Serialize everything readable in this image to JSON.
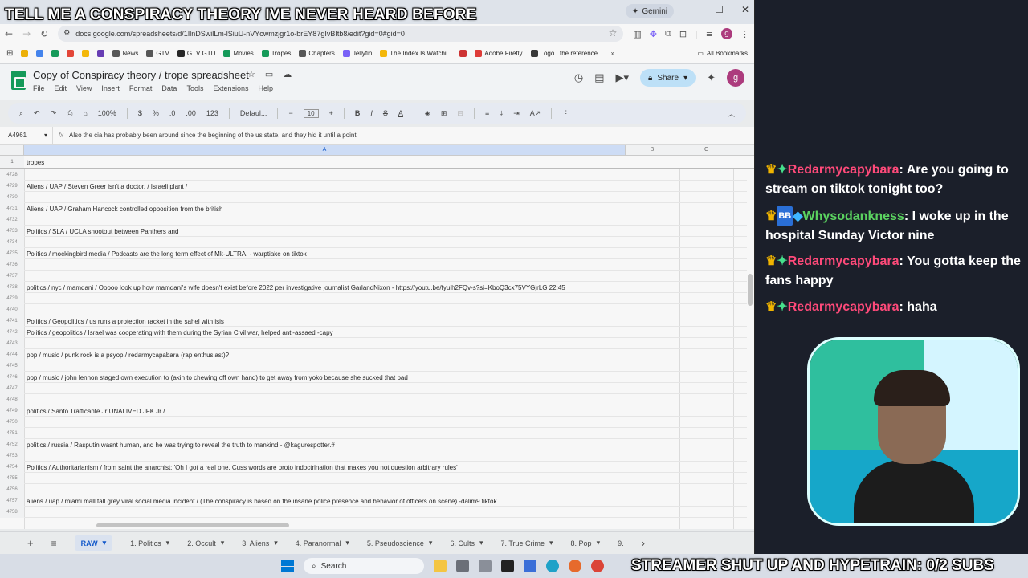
{
  "stream": {
    "banner": "TELL ME A CONSPIRACY THEORY IVE NEVER HEARD BEFORE",
    "hypetrain": "STREAMER SHUT UP AND HYPETRAIN: 0/2 SUBS"
  },
  "browser": {
    "gemini_label": "Gemini",
    "url": "docs.google.com/spreadsheets/d/1IlnDSwilLm-lSiuU-nVYcwmzjgr1o-brEY87gIvBItb8/edit?gid=0#gid=0",
    "profile_initial": "g",
    "bookmarks": [
      {
        "label": "",
        "color": "#f4b400"
      },
      {
        "label": "",
        "color": "#4285f4"
      },
      {
        "label": "",
        "color": "#0f9d58"
      },
      {
        "label": "",
        "color": "#ea4335"
      },
      {
        "label": "",
        "color": "#fbbc04"
      },
      {
        "label": "",
        "color": "#673ab7"
      },
      {
        "label": "News",
        "color": "#555555"
      },
      {
        "label": "GTV",
        "color": "#555555"
      },
      {
        "label": "GTV GTD",
        "color": "#222222"
      },
      {
        "label": "Movies",
        "color": "#0f9d58"
      },
      {
        "label": "Tropes",
        "color": "#0f9d58"
      },
      {
        "label": "Chapters",
        "color": "#555555"
      },
      {
        "label": "Jellyfin",
        "color": "#7b61ff"
      },
      {
        "label": "The Index Is Watchi...",
        "color": "#fbbc04"
      },
      {
        "label": "",
        "color": "#d32f2f"
      },
      {
        "label": "Adobe Firefly",
        "color": "#e53935"
      },
      {
        "label": "Logo : the reference...",
        "color": "#333333"
      }
    ],
    "all_bookmarks": "All Bookmarks"
  },
  "sheets": {
    "title": "Copy of Conspiracy theory / trope spreadsheet",
    "menu": [
      "File",
      "Edit",
      "View",
      "Insert",
      "Format",
      "Data",
      "Tools",
      "Extensions",
      "Help"
    ],
    "share_label": "Share",
    "avatar_initial": "g",
    "toolbar": {
      "zoom": "100%",
      "currency": "$",
      "percent": "%",
      "dec_minus": ".0",
      "dec_plus": ".00",
      "number_format": "123",
      "font": "Defaul...",
      "font_size": "10"
    },
    "name_box": "A4961",
    "formula": "Also the cia has probably been around since the beginning of the us state, and they hid it until a point",
    "columns": {
      "a": "A",
      "b": "B",
      "c": "C"
    },
    "frozen_row": {
      "num": "1",
      "text": "tropes"
    },
    "rows": [
      {
        "num": "4728",
        "text": ""
      },
      {
        "num": "4729",
        "text": "Aliens / UAP / Steven Greer isn't a doctor. / Israeli plant /"
      },
      {
        "num": "4730",
        "text": ""
      },
      {
        "num": "4731",
        "text": "Aliens / UAP / Graham Hancock controlled opposition from the british"
      },
      {
        "num": "4732",
        "text": ""
      },
      {
        "num": "4733",
        "text": "Politics / SLA / UCLA shootout between Panthers and"
      },
      {
        "num": "4734",
        "text": ""
      },
      {
        "num": "4735",
        "text": "Politics / mockingbird media / Podcasts are the long term effect of Mk-ULTRA. - warptiake on tiktok"
      },
      {
        "num": "4736",
        "text": ""
      },
      {
        "num": "4737",
        "text": ""
      },
      {
        "num": "4738",
        "text": "politics / nyc / mamdani / Ooooo look up how mamdani's wife doesn't exist before 2022 per investigative journalist GarlandNixon - https://youtu.be/fyuih2FQv-s?si=KboQ3cx75VYGjrLG 22:45"
      },
      {
        "num": "4739",
        "text": ""
      },
      {
        "num": "4740",
        "text": ""
      },
      {
        "num": "4741",
        "text": "Politics / Geopolitics / us runs a protection racket in the sahel with isis"
      },
      {
        "num": "4742",
        "text": "Politics / geopolitics / Israel was cooperating with them during the Syrian Civil war, helped anti-assaed -capy"
      },
      {
        "num": "4743",
        "text": ""
      },
      {
        "num": "4744",
        "text": "pop / music / punk rock is a psyop / redarmycapabara (rap enthusiast)?"
      },
      {
        "num": "4745",
        "text": ""
      },
      {
        "num": "4746",
        "text": "pop / music / john lennon staged own execution to (akin to chewing off own hand) to get away from yoko because she sucked that bad"
      },
      {
        "num": "4747",
        "text": ""
      },
      {
        "num": "4748",
        "text": ""
      },
      {
        "num": "4749",
        "text": "politics / Santo Trafficante Jr UNALIVED JFK Jr /"
      },
      {
        "num": "4750",
        "text": ""
      },
      {
        "num": "4751",
        "text": ""
      },
      {
        "num": "4752",
        "text": "politics / russia / Rasputin wasnt human, and he was trying to reveal the truth to mankind.- @kagurespotter.#"
      },
      {
        "num": "4753",
        "text": ""
      },
      {
        "num": "4754",
        "text": "Politics / Authoritarianism / from saint the anarchist: 'Oh I got a real one. Cuss words are proto indoctrination that makes you not question arbitrary rules'"
      },
      {
        "num": "4755",
        "text": ""
      },
      {
        "num": "4756",
        "text": ""
      },
      {
        "num": "4757",
        "text": "aliens / uap / miami mall tall grey viral social media incident / (The conspiracy is based on the insane police presence and behavior of officers on scene) -dalim9 tiktok"
      },
      {
        "num": "4758",
        "text": ""
      }
    ],
    "tabs": [
      "RAW",
      "1. Politics",
      "2. Occult",
      "3. Aliens",
      "4. Paranormal",
      "5. Pseudoscience",
      "6. Cults",
      "7. True Crime",
      "8. Pop",
      "9."
    ]
  },
  "chat": [
    {
      "user": "Redarmycapybara",
      "text": "Are you going to stream on tiktok tonight too?",
      "badges": [
        "crown",
        "gem"
      ]
    },
    {
      "user": "Whysodankness",
      "text": "I woke up in the hospital Sunday Victor nine",
      "badges": [
        "crown",
        "bb",
        "cube"
      ]
    },
    {
      "user": "Redarmycapybara",
      "text": "You gotta keep the fans happy",
      "badges": [
        "crown",
        "gem"
      ]
    },
    {
      "user": "Redarmycapybara",
      "text": "haha",
      "badges": [
        "crown",
        "gem"
      ]
    }
  ],
  "taskbar": {
    "search_placeholder": "Search"
  }
}
